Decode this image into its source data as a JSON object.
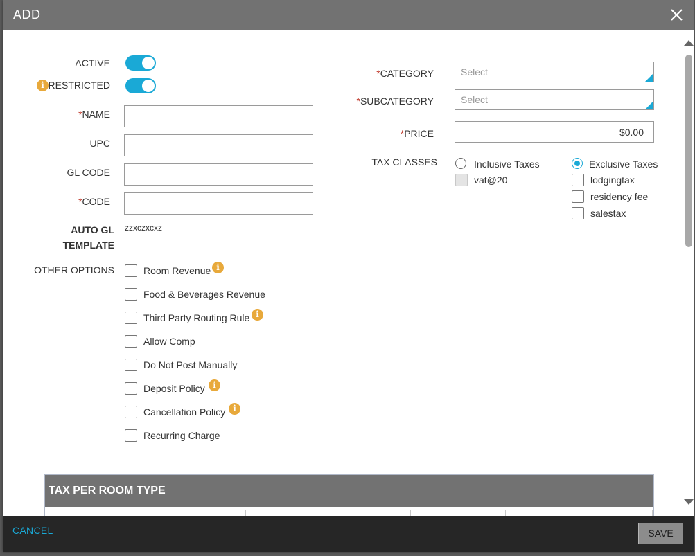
{
  "header": {
    "title": "ADD",
    "close_icon": "close-icon"
  },
  "colors": {
    "accent": "#1aa9d6",
    "header_bg": "#727272",
    "footer_bg": "#262626",
    "required": "#c0392b",
    "info": "#e8a93b"
  },
  "left": {
    "active": {
      "label": "ACTIVE",
      "on": true
    },
    "restricted": {
      "label": "RESTRICTED",
      "on": true
    },
    "required_mark": "*",
    "name": {
      "label": "NAME",
      "value": ""
    },
    "upc": {
      "label": "UPC",
      "value": ""
    },
    "gl_code": {
      "label": "GL CODE",
      "value": ""
    },
    "code": {
      "label": "CODE",
      "value": ""
    },
    "auto_gl_template": {
      "label_line1": "AUTO GL",
      "label_line2": "TEMPLATE",
      "value": "zzxczxcxz"
    },
    "other_options": {
      "label": "OTHER OPTIONS",
      "items": [
        {
          "label": "Room Revenue",
          "checked": false,
          "info": true
        },
        {
          "label": "Food & Beverages Revenue",
          "checked": false,
          "info": false
        },
        {
          "label": "Third Party Routing Rule",
          "checked": false,
          "info": true
        },
        {
          "label": "Allow Comp",
          "checked": false,
          "info": false
        },
        {
          "label": "Do Not Post Manually",
          "checked": false,
          "info": false
        },
        {
          "label": "Deposit Policy",
          "checked": false,
          "info": true
        },
        {
          "label": "Cancellation Policy",
          "checked": false,
          "info": true
        },
        {
          "label": "Recurring Charge",
          "checked": false,
          "info": false
        }
      ]
    }
  },
  "right": {
    "category": {
      "label": "CATEGORY",
      "placeholder": "Select"
    },
    "subcategory": {
      "label": "SUBCATEGORY",
      "placeholder": "Select"
    },
    "price": {
      "label": "PRICE",
      "value": "$0.00"
    },
    "tax_classes": {
      "label": "TAX CLASSES",
      "inclusive": {
        "label": "Inclusive Taxes",
        "selected": false,
        "items": [
          {
            "label": "vat@20",
            "checked": false,
            "disabled": true
          }
        ]
      },
      "exclusive": {
        "label": "Exclusive Taxes",
        "selected": true,
        "items": [
          {
            "label": "lodgingtax",
            "checked": false
          },
          {
            "label": "residency fee",
            "checked": false
          },
          {
            "label": "salestax",
            "checked": false
          }
        ]
      }
    }
  },
  "tax_per_room_type": {
    "title": "TAX PER ROOM TYPE"
  },
  "footer": {
    "cancel_label": "CANCEL",
    "save_label": "SAVE"
  }
}
